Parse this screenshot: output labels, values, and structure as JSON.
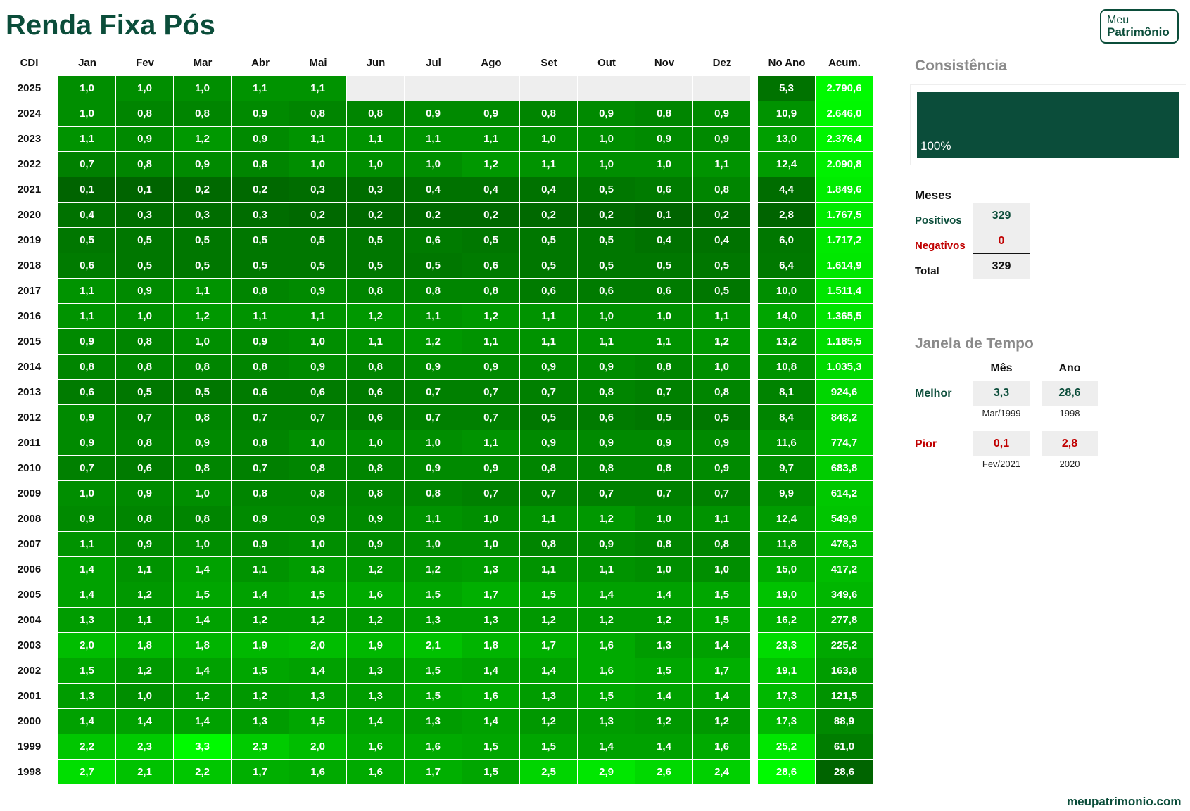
{
  "title": "Renda Fixa Pós",
  "logo": {
    "line1": "Meu",
    "line2": "Patrimônio"
  },
  "table": {
    "corner_label": "CDI",
    "months": [
      "Jan",
      "Fev",
      "Mar",
      "Abr",
      "Mai",
      "Jun",
      "Jul",
      "Ago",
      "Set",
      "Out",
      "Nov",
      "Dez"
    ],
    "year_header": "No Ano",
    "acum_header": "Acum.",
    "rows": [
      {
        "year": "2025",
        "m": [
          "1,0",
          "1,0",
          "1,0",
          "1,1",
          "1,1",
          "",
          "",
          "",
          "",
          "",
          "",
          ""
        ],
        "ano": "5,3",
        "acum": "2.790,6"
      },
      {
        "year": "2024",
        "m": [
          "1,0",
          "0,8",
          "0,8",
          "0,9",
          "0,8",
          "0,8",
          "0,9",
          "0,9",
          "0,8",
          "0,9",
          "0,8",
          "0,9"
        ],
        "ano": "10,9",
        "acum": "2.646,0"
      },
      {
        "year": "2023",
        "m": [
          "1,1",
          "0,9",
          "1,2",
          "0,9",
          "1,1",
          "1,1",
          "1,1",
          "1,1",
          "1,0",
          "1,0",
          "0,9",
          "0,9"
        ],
        "ano": "13,0",
        "acum": "2.376,4"
      },
      {
        "year": "2022",
        "m": [
          "0,7",
          "0,8",
          "0,9",
          "0,8",
          "1,0",
          "1,0",
          "1,0",
          "1,2",
          "1,1",
          "1,0",
          "1,0",
          "1,1"
        ],
        "ano": "12,4",
        "acum": "2.090,8"
      },
      {
        "year": "2021",
        "m": [
          "0,1",
          "0,1",
          "0,2",
          "0,2",
          "0,3",
          "0,3",
          "0,4",
          "0,4",
          "0,4",
          "0,5",
          "0,6",
          "0,8"
        ],
        "ano": "4,4",
        "acum": "1.849,6"
      },
      {
        "year": "2020",
        "m": [
          "0,4",
          "0,3",
          "0,3",
          "0,3",
          "0,2",
          "0,2",
          "0,2",
          "0,2",
          "0,2",
          "0,2",
          "0,1",
          "0,2"
        ],
        "ano": "2,8",
        "acum": "1.767,5"
      },
      {
        "year": "2019",
        "m": [
          "0,5",
          "0,5",
          "0,5",
          "0,5",
          "0,5",
          "0,5",
          "0,6",
          "0,5",
          "0,5",
          "0,5",
          "0,4",
          "0,4"
        ],
        "ano": "6,0",
        "acum": "1.717,2"
      },
      {
        "year": "2018",
        "m": [
          "0,6",
          "0,5",
          "0,5",
          "0,5",
          "0,5",
          "0,5",
          "0,5",
          "0,6",
          "0,5",
          "0,5",
          "0,5",
          "0,5"
        ],
        "ano": "6,4",
        "acum": "1.614,9"
      },
      {
        "year": "2017",
        "m": [
          "1,1",
          "0,9",
          "1,1",
          "0,8",
          "0,9",
          "0,8",
          "0,8",
          "0,8",
          "0,6",
          "0,6",
          "0,6",
          "0,5"
        ],
        "ano": "10,0",
        "acum": "1.511,4"
      },
      {
        "year": "2016",
        "m": [
          "1,1",
          "1,0",
          "1,2",
          "1,1",
          "1,1",
          "1,2",
          "1,1",
          "1,2",
          "1,1",
          "1,0",
          "1,0",
          "1,1"
        ],
        "ano": "14,0",
        "acum": "1.365,5"
      },
      {
        "year": "2015",
        "m": [
          "0,9",
          "0,8",
          "1,0",
          "0,9",
          "1,0",
          "1,1",
          "1,2",
          "1,1",
          "1,1",
          "1,1",
          "1,1",
          "1,2"
        ],
        "ano": "13,2",
        "acum": "1.185,5"
      },
      {
        "year": "2014",
        "m": [
          "0,8",
          "0,8",
          "0,8",
          "0,8",
          "0,9",
          "0,8",
          "0,9",
          "0,9",
          "0,9",
          "0,9",
          "0,8",
          "1,0"
        ],
        "ano": "10,8",
        "acum": "1.035,3"
      },
      {
        "year": "2013",
        "m": [
          "0,6",
          "0,5",
          "0,5",
          "0,6",
          "0,6",
          "0,6",
          "0,7",
          "0,7",
          "0,7",
          "0,8",
          "0,7",
          "0,8"
        ],
        "ano": "8,1",
        "acum": "924,6"
      },
      {
        "year": "2012",
        "m": [
          "0,9",
          "0,7",
          "0,8",
          "0,7",
          "0,7",
          "0,6",
          "0,7",
          "0,7",
          "0,5",
          "0,6",
          "0,5",
          "0,5"
        ],
        "ano": "8,4",
        "acum": "848,2"
      },
      {
        "year": "2011",
        "m": [
          "0,9",
          "0,8",
          "0,9",
          "0,8",
          "1,0",
          "1,0",
          "1,0",
          "1,1",
          "0,9",
          "0,9",
          "0,9",
          "0,9"
        ],
        "ano": "11,6",
        "acum": "774,7"
      },
      {
        "year": "2010",
        "m": [
          "0,7",
          "0,6",
          "0,8",
          "0,7",
          "0,8",
          "0,8",
          "0,9",
          "0,9",
          "0,8",
          "0,8",
          "0,8",
          "0,9"
        ],
        "ano": "9,7",
        "acum": "683,8"
      },
      {
        "year": "2009",
        "m": [
          "1,0",
          "0,9",
          "1,0",
          "0,8",
          "0,8",
          "0,8",
          "0,8",
          "0,7",
          "0,7",
          "0,7",
          "0,7",
          "0,7"
        ],
        "ano": "9,9",
        "acum": "614,2"
      },
      {
        "year": "2008",
        "m": [
          "0,9",
          "0,8",
          "0,8",
          "0,9",
          "0,9",
          "0,9",
          "1,1",
          "1,0",
          "1,1",
          "1,2",
          "1,0",
          "1,1"
        ],
        "ano": "12,4",
        "acum": "549,9"
      },
      {
        "year": "2007",
        "m": [
          "1,1",
          "0,9",
          "1,0",
          "0,9",
          "1,0",
          "0,9",
          "1,0",
          "1,0",
          "0,8",
          "0,9",
          "0,8",
          "0,8"
        ],
        "ano": "11,8",
        "acum": "478,3"
      },
      {
        "year": "2006",
        "m": [
          "1,4",
          "1,1",
          "1,4",
          "1,1",
          "1,3",
          "1,2",
          "1,2",
          "1,3",
          "1,1",
          "1,1",
          "1,0",
          "1,0"
        ],
        "ano": "15,0",
        "acum": "417,2"
      },
      {
        "year": "2005",
        "m": [
          "1,4",
          "1,2",
          "1,5",
          "1,4",
          "1,5",
          "1,6",
          "1,5",
          "1,7",
          "1,5",
          "1,4",
          "1,4",
          "1,5"
        ],
        "ano": "19,0",
        "acum": "349,6"
      },
      {
        "year": "2004",
        "m": [
          "1,3",
          "1,1",
          "1,4",
          "1,2",
          "1,2",
          "1,2",
          "1,3",
          "1,3",
          "1,2",
          "1,2",
          "1,2",
          "1,5"
        ],
        "ano": "16,2",
        "acum": "277,8"
      },
      {
        "year": "2003",
        "m": [
          "2,0",
          "1,8",
          "1,8",
          "1,9",
          "2,0",
          "1,9",
          "2,1",
          "1,8",
          "1,7",
          "1,6",
          "1,3",
          "1,4"
        ],
        "ano": "23,3",
        "acum": "225,2"
      },
      {
        "year": "2002",
        "m": [
          "1,5",
          "1,2",
          "1,4",
          "1,5",
          "1,4",
          "1,3",
          "1,5",
          "1,4",
          "1,4",
          "1,6",
          "1,5",
          "1,7"
        ],
        "ano": "19,1",
        "acum": "163,8"
      },
      {
        "year": "2001",
        "m": [
          "1,3",
          "1,0",
          "1,2",
          "1,2",
          "1,3",
          "1,3",
          "1,5",
          "1,6",
          "1,3",
          "1,5",
          "1,4",
          "1,4"
        ],
        "ano": "17,3",
        "acum": "121,5"
      },
      {
        "year": "2000",
        "m": [
          "1,4",
          "1,4",
          "1,4",
          "1,3",
          "1,5",
          "1,4",
          "1,3",
          "1,4",
          "1,2",
          "1,3",
          "1,2",
          "1,2"
        ],
        "ano": "17,3",
        "acum": "88,9"
      },
      {
        "year": "1999",
        "m": [
          "2,2",
          "2,3",
          "3,3",
          "2,3",
          "2,0",
          "1,6",
          "1,6",
          "1,5",
          "1,5",
          "1,4",
          "1,4",
          "1,6"
        ],
        "ano": "25,2",
        "acum": "61,0"
      },
      {
        "year": "1998",
        "m": [
          "2,7",
          "2,1",
          "2,2",
          "1,7",
          "1,6",
          "1,6",
          "1,7",
          "1,5",
          "2,5",
          "2,9",
          "2,6",
          "2,4"
        ],
        "ano": "28,6",
        "acum": "28,6"
      }
    ]
  },
  "consistencia": {
    "title": "Consistência",
    "value": "100%",
    "fraction": 1.0
  },
  "meses": {
    "title": "Meses",
    "positivos_label": "Positivos",
    "positivos": "329",
    "negativos_label": "Negativos",
    "negativos": "0",
    "total_label": "Total",
    "total": "329"
  },
  "janela": {
    "title": "Janela de Tempo",
    "col_mes": "Mês",
    "col_ano": "Ano",
    "melhor_label": "Melhor",
    "melhor_mes": "3,3",
    "melhor_mes_date": "Mar/1999",
    "melhor_ano": "28,6",
    "melhor_ano_date": "1998",
    "pior_label": "Pior",
    "pior_mes": "0,1",
    "pior_mes_date": "Fev/2021",
    "pior_ano": "2,8",
    "pior_ano_date": "2020"
  },
  "footer": "meupatrimonio.com",
  "colors": {
    "brand": "#0b4d3a",
    "negative": "#c00000",
    "empty_cell": "#eeeeee"
  }
}
